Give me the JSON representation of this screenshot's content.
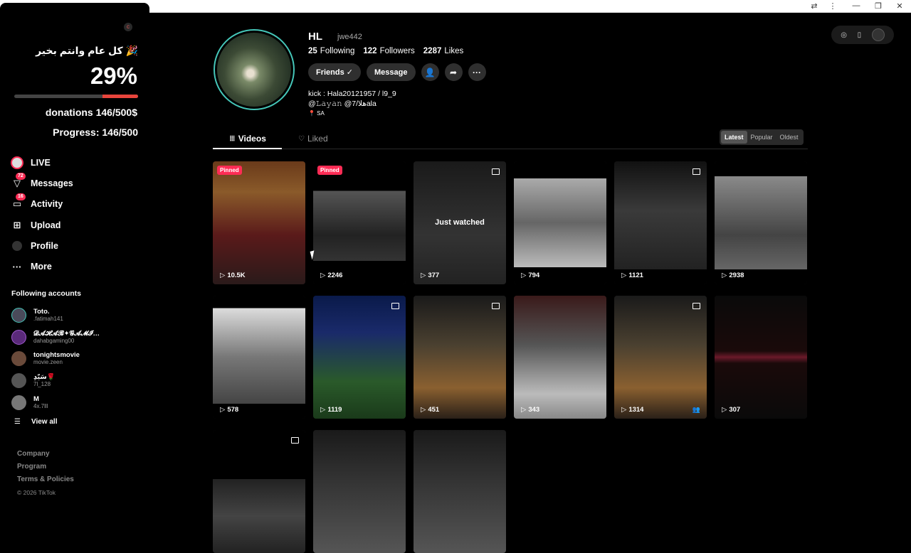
{
  "overlay": {
    "badge": "c",
    "greeting": "كل عام وانتم بخير 🎉",
    "percent_text": "29%",
    "progress_fraction": 0.29,
    "donations": "donations 146/500$",
    "progress": "Progress: 146/500"
  },
  "nav": {
    "items": [
      {
        "label": "LIVE",
        "icon": "live-icon"
      },
      {
        "label": "Messages",
        "icon": "messages-icon",
        "badge": "72"
      },
      {
        "label": "Activity",
        "icon": "activity-icon",
        "badge": "16"
      },
      {
        "label": "Upload",
        "icon": "upload-icon"
      },
      {
        "label": "Profile",
        "icon": "profile-icon"
      },
      {
        "label": "More",
        "icon": "more-icon"
      }
    ]
  },
  "following": {
    "title": "Following accounts",
    "accounts": [
      {
        "name": "Toto.",
        "user": ".fatimah141",
        "color": "#4a4a5a"
      },
      {
        "name": "𝓓𝓐𝓗𝓐𝓑✦𝓖𝓐𝓜𝓘…",
        "user": "dahabgaming00",
        "color": "#5a2a7a"
      },
      {
        "name": "tonightsmovie",
        "user": "movie.zeen",
        "color": "#6a4a3a"
      },
      {
        "name": "سَيّدِ🌹",
        "user": "7l_128",
        "color": "#555555"
      },
      {
        "name": "M",
        "user": "4x.7lll",
        "color": "#777777"
      }
    ],
    "view_all": "View all"
  },
  "footer": {
    "company": "Company",
    "program": "Program",
    "terms": "Terms & Policies",
    "copyright": "© 2026 TikTok"
  },
  "profile": {
    "name": "HL",
    "username": "jwe442",
    "following_count": "25",
    "following_label": "Following",
    "followers_count": "122",
    "followers_label": "Followers",
    "likes_count": "2287",
    "likes_label": "Likes",
    "friends_button": "Friends ✓",
    "message_button": "Message",
    "bio_line1": "kick : Hala20121957 / l9_9",
    "bio_line2": "@𝙻𝚊𝚢𝚊𝚗 @7/هلاala",
    "location": "📍 SA"
  },
  "tabs": {
    "videos": "Videos",
    "liked": "Liked"
  },
  "sort": {
    "latest": "Latest",
    "popular": "Popular",
    "oldest": "Oldest",
    "active": "latest"
  },
  "videos": [
    {
      "views": "10.5K",
      "pinned": "Pinned",
      "bg": "linear-gradient(180deg,#6a3a1a 0%,#8a5a2a 25%,#5a1a1a 60%,#2a1a1a 100%)",
      "multi": false
    },
    {
      "views": "2246",
      "pinned": "Pinned",
      "bg": "linear-gradient(180deg,#000 0%,#000 24%,#555 24%,#222 60%,#333 81%,#000 81%)",
      "multi": false
    },
    {
      "views": "377",
      "just_watched": "Just watched",
      "bg": "linear-gradient(180deg,#1a1a1a,#333 60%,#222)",
      "multi": true
    },
    {
      "views": "794",
      "bg": "linear-gradient(180deg,#000 0%,#000 14%,#aaa 14%,#666 50%,#bbb 86%,#000 86%)",
      "multi": false
    },
    {
      "views": "1121",
      "bg": "linear-gradient(180deg,#111 0%,#3a3a3a 40%,#222 88%,#000 88%)",
      "multi": true
    },
    {
      "views": "2938",
      "bg": "linear-gradient(180deg,#000 0%,#000 12%,#8a8a8a 12%,#444 60%,#666 88%,#000 88%)",
      "multi": false
    },
    {
      "views": "578",
      "bg": "linear-gradient(180deg,#000 0%,#000 10%,#ddd 10%,#777 50%,#444 88%,#000 88%)",
      "multi": false
    },
    {
      "views": "1119",
      "bg": "linear-gradient(180deg,#0a1a4a 0%,#1a2a6a 30%,#2a5a2a 70%,#1a3a1a 100%)",
      "multi": true
    },
    {
      "views": "451",
      "bg": "linear-gradient(180deg,#1a1a1a 0%,#4a4030 40%,#8a6030 75%,#2a2018 100%)",
      "multi": true
    },
    {
      "views": "343",
      "bg": "linear-gradient(180deg,#3a1a1a 0%,#555 40%,#bbb 80%,#888 100%)",
      "multi": false
    },
    {
      "views": "1314",
      "bg": "linear-gradient(180deg,#1a1a1a 0%,#4a4030 40%,#8a6030 75%,#2a2018 100%)",
      "multi": true,
      "friends": true
    },
    {
      "views": "307",
      "bg": "linear-gradient(180deg,#0a0a0a 0%,#1a0a0a 45%,#6a1a2a 50%,#1a0a0a 55%,#0a0a0a 100%)",
      "multi": false
    },
    {
      "views": "",
      "bg": "linear-gradient(180deg,#000 0%,#000 40%,#222 40%,#444 70%,#222 100%)",
      "multi": true
    },
    {
      "views": "",
      "bg": "linear-gradient(180deg,#1a1a1a 0%,#333 40%,#555 100%)",
      "multi": false
    },
    {
      "views": "",
      "bg": "linear-gradient(180deg,#1a1a1a 0%,#333 40%,#555 100%)",
      "multi": false
    }
  ]
}
